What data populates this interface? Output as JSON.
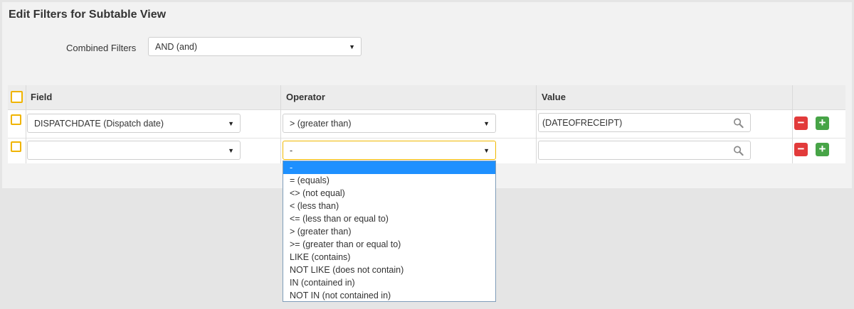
{
  "page": {
    "title": "Edit Filters for Subtable View"
  },
  "combined_filters": {
    "label": "Combined Filters",
    "value": "AND (and)"
  },
  "grid": {
    "headers": {
      "field": "Field",
      "operator": "Operator",
      "value": "Value"
    },
    "rows": [
      {
        "field": "DISPATCHDATE (Dispatch date)",
        "operator": "> (greater than)",
        "value": "(DATEOFRECEIPT)"
      },
      {
        "field": "",
        "operator": "-",
        "value": ""
      }
    ],
    "remove_glyph": "−",
    "add_glyph": "+"
  },
  "operator_dropdown": {
    "selected_index": 0,
    "options": [
      "-",
      "= (equals)",
      "<> (not equal)",
      "< (less than)",
      "<= (less than or equal to)",
      "> (greater than)",
      ">= (greater than or equal to)",
      "LIKE (contains)",
      "NOT LIKE (does not contain)",
      "IN (contained in)",
      "NOT IN (not contained in)"
    ]
  },
  "icons": {
    "select_arrow": "triangle-down-icon",
    "search": "magnifier-icon"
  },
  "colors": {
    "accent": "#f0b400",
    "remove": "#e23b3b",
    "add": "#47a447",
    "dropdown_selected": "#1e90ff"
  }
}
